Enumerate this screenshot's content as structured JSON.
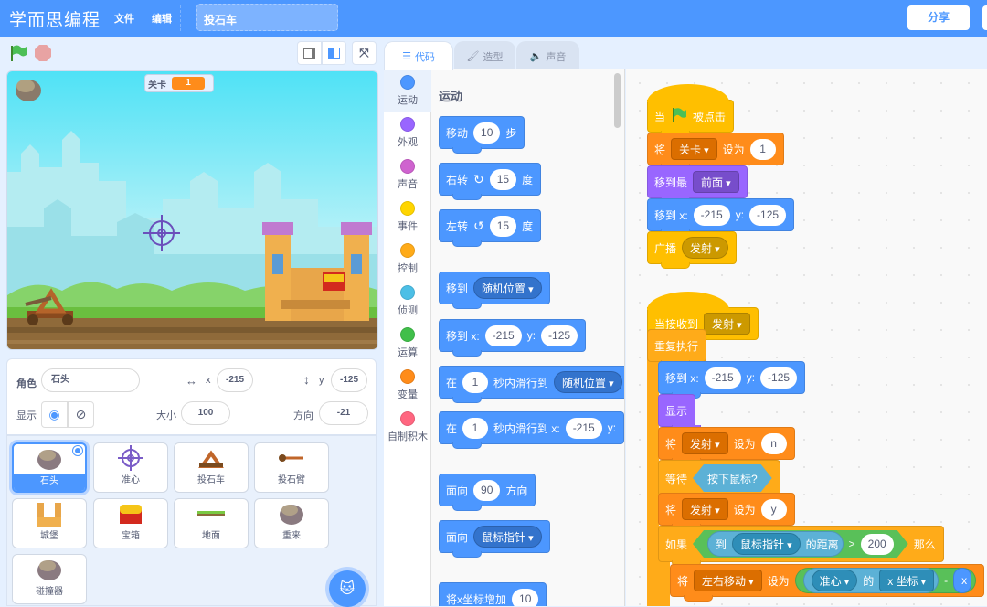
{
  "app": {
    "title": "学而思编程",
    "menu": [
      "文件",
      "编辑"
    ],
    "project_name": "投石车",
    "share_label": "分享"
  },
  "stage": {
    "monitor": {
      "label": "关卡",
      "value": "1"
    }
  },
  "sprite_info": {
    "sprite_label": "角色",
    "sprite_name": "石头",
    "x_label": "x",
    "x": "-215",
    "y_label": "y",
    "y": "-125",
    "show_label": "显示",
    "size_label": "大小",
    "size": "100",
    "direction_label": "方向",
    "direction": "-21"
  },
  "sprites": [
    "石头",
    "准心",
    "投石车",
    "投石臂",
    "城堡",
    "宝箱",
    "地面",
    "重来",
    "碰撞器"
  ],
  "tabs": [
    "代码",
    "造型",
    "声音"
  ],
  "categories": [
    {
      "label": "运动",
      "color": "#4c97ff"
    },
    {
      "label": "外观",
      "color": "#9966ff"
    },
    {
      "label": "声音",
      "color": "#cf63cf"
    },
    {
      "label": "事件",
      "color": "#ffd500"
    },
    {
      "label": "控制",
      "color": "#ffab19"
    },
    {
      "label": "侦测",
      "color": "#4cbfe6"
    },
    {
      "label": "运算",
      "color": "#40bf4a"
    },
    {
      "label": "变量",
      "color": "#ff8c1a"
    },
    {
      "label": "自制积木",
      "color": "#ff6680"
    }
  ],
  "colors": {
    "motion": "#4c97ff",
    "looks": "#9966ff",
    "events": "#ffbf00",
    "control": "#ffab19",
    "sensing": "#5cb1d6",
    "operators": "#59c059",
    "variables": "#ff8c1a",
    "topbar": "#4c97ff"
  },
  "palette": {
    "title": "运动",
    "blocks": [
      {
        "cat": "motion",
        "parts": [
          {
            "text": "移动"
          },
          {
            "num": "10"
          },
          {
            "text": "步"
          }
        ]
      },
      {
        "cat": "motion",
        "parts": [
          {
            "text": "右转"
          },
          {
            "icon": "↻"
          },
          {
            "num": "15"
          },
          {
            "text": "度"
          }
        ]
      },
      {
        "cat": "motion",
        "parts": [
          {
            "text": "左转"
          },
          {
            "icon": "↺"
          },
          {
            "num": "15"
          },
          {
            "text": "度"
          }
        ]
      },
      {
        "cat": "motion",
        "parts": [
          {
            "text": "移到"
          },
          {
            "drop": "随机位置"
          }
        ]
      },
      {
        "cat": "motion",
        "parts": [
          {
            "text": "移到 x:"
          },
          {
            "num": "-215"
          },
          {
            "text": "y:"
          },
          {
            "num": "-125"
          }
        ]
      },
      {
        "cat": "motion",
        "parts": [
          {
            "text": "在"
          },
          {
            "num": "1"
          },
          {
            "text": "秒内滑行到"
          },
          {
            "drop": "随机位置"
          }
        ]
      },
      {
        "cat": "motion",
        "parts": [
          {
            "text": "在"
          },
          {
            "num": "1"
          },
          {
            "text": "秒内滑行到 x:"
          },
          {
            "num": "-215"
          },
          {
            "text": "y:"
          }
        ]
      },
      {
        "cat": "motion",
        "parts": [
          {
            "text": "面向"
          },
          {
            "num": "90"
          },
          {
            "text": "方向"
          }
        ]
      },
      {
        "cat": "motion",
        "parts": [
          {
            "text": "面向"
          },
          {
            "drop": "鼠标指针"
          }
        ]
      },
      {
        "cat": "motion",
        "parts": [
          {
            "text": "将x坐标增加"
          },
          {
            "num": "10"
          }
        ]
      }
    ]
  },
  "code": {
    "blocks": [
      {
        "cat": "events",
        "hat": true,
        "parts": [
          {
            "text": "当"
          },
          {
            "icon": "green-flag"
          },
          {
            "text": "被点击"
          }
        ]
      },
      {
        "cat": "variables",
        "parts": [
          {
            "text": "将"
          },
          {
            "sq": "关卡"
          },
          {
            "text": "设为"
          },
          {
            "num": "1"
          }
        ]
      },
      {
        "cat": "looks",
        "parts": [
          {
            "text": "移到最"
          },
          {
            "sq": "前面"
          }
        ]
      },
      {
        "cat": "motion",
        "parts": [
          {
            "text": "移到 x:"
          },
          {
            "num": "-215"
          },
          {
            "text": "y:"
          },
          {
            "num": "-125"
          }
        ]
      },
      {
        "cat": "events",
        "parts": [
          {
            "text": "广播"
          },
          {
            "drop": "发射"
          }
        ]
      },
      {
        "cat": "events",
        "hat": true,
        "parts": [
          {
            "text": "当接收到"
          },
          {
            "sq": "发射"
          }
        ]
      },
      {
        "cat": "control",
        "parts": [
          {
            "text": "重复执行"
          }
        ]
      },
      {
        "cat": "motion",
        "parts": [
          {
            "text": "移到 x:"
          },
          {
            "num": "-215"
          },
          {
            "text": "y:"
          },
          {
            "num": "-125"
          }
        ]
      },
      {
        "cat": "looks",
        "parts": [
          {
            "text": "显示"
          }
        ]
      },
      {
        "cat": "variables",
        "parts": [
          {
            "text": "将"
          },
          {
            "sq": "发射"
          },
          {
            "text": "设为"
          },
          {
            "num": "n"
          }
        ]
      },
      {
        "cat": "control",
        "parts": [
          {
            "text": "等待"
          },
          {
            "bool": "sensing",
            "parts": [
              {
                "text": "按下鼠标?"
              }
            ]
          }
        ]
      },
      {
        "cat": "variables",
        "parts": [
          {
            "text": "将"
          },
          {
            "sq": "发射"
          },
          {
            "text": "设为"
          },
          {
            "num": "y"
          }
        ]
      },
      {
        "cat": "control",
        "parts": [
          {
            "text": "如果"
          },
          {
            "bool": "operators",
            "parts": [
              {
                "rep": "sensing",
                "parts": [
                  {
                    "text": "到"
                  },
                  {
                    "drop": "鼠标指针"
                  },
                  {
                    "text": "的距离"
                  }
                ]
              },
              {
                "text": ">"
              },
              {
                "num": "200"
              }
            ]
          },
          {
            "text": "那么"
          }
        ]
      },
      {
        "cat": "variables",
        "parts": [
          {
            "text": "将"
          },
          {
            "sq": "左右移动"
          },
          {
            "text": "设为"
          },
          {
            "rep": "operators",
            "parts": [
              {
                "rep": "sensing",
                "parts": [
                  {
                    "drop": "准心"
                  },
                  {
                    "text": "的"
                  },
                  {
                    "sq": "x 坐标"
                  }
                ]
              },
              {
                "text": "-"
              },
              {
                "rep": "motion",
                "parts": [
                  {
                    "text": "x"
                  }
                ]
              }
            ]
          }
        ]
      }
    ]
  }
}
